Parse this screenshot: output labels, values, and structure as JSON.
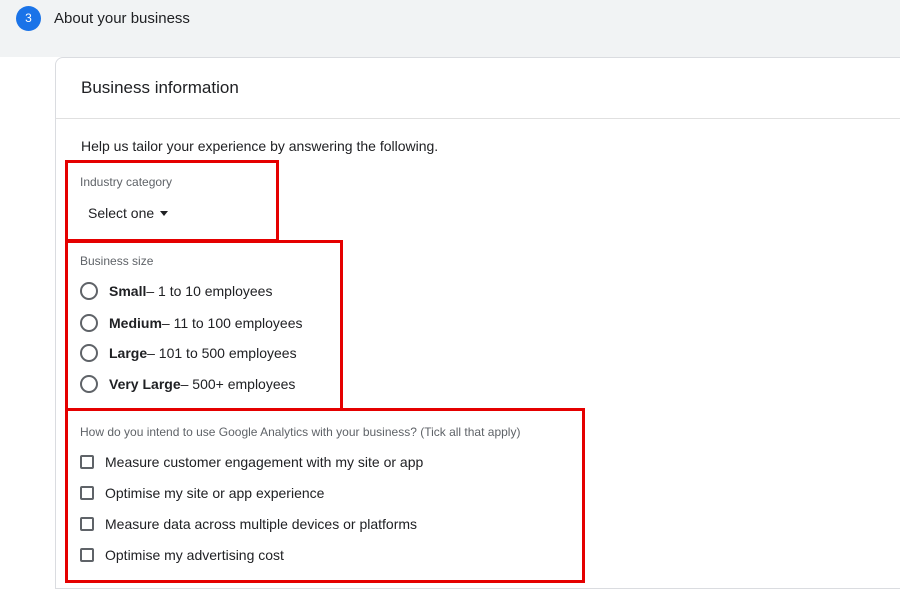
{
  "step": {
    "number": "3",
    "title": "About your business"
  },
  "card": {
    "title": "Business information",
    "intro": "Help us tailor your experience by answering the following."
  },
  "industry": {
    "label": "Industry category",
    "selected": "Select one"
  },
  "business_size": {
    "label": "Business size",
    "options": [
      {
        "name": "Small",
        "desc": " – 1 to 10 employees"
      },
      {
        "name": "Medium",
        "desc": " – 11 to 100 employees"
      },
      {
        "name": "Large",
        "desc": " – 101 to 500 employees"
      },
      {
        "name": "Very Large",
        "desc": " – 500+ employees"
      }
    ]
  },
  "usage": {
    "label": "How do you intend to use Google Analytics with your business? (Tick all that apply)",
    "options": [
      "Measure customer engagement with my site or app",
      "Optimise my site or app experience",
      "Measure data across multiple devices or platforms",
      "Optimise my advertising cost"
    ]
  },
  "colors": {
    "accent": "#1a73e8",
    "highlight": "#e50000"
  }
}
